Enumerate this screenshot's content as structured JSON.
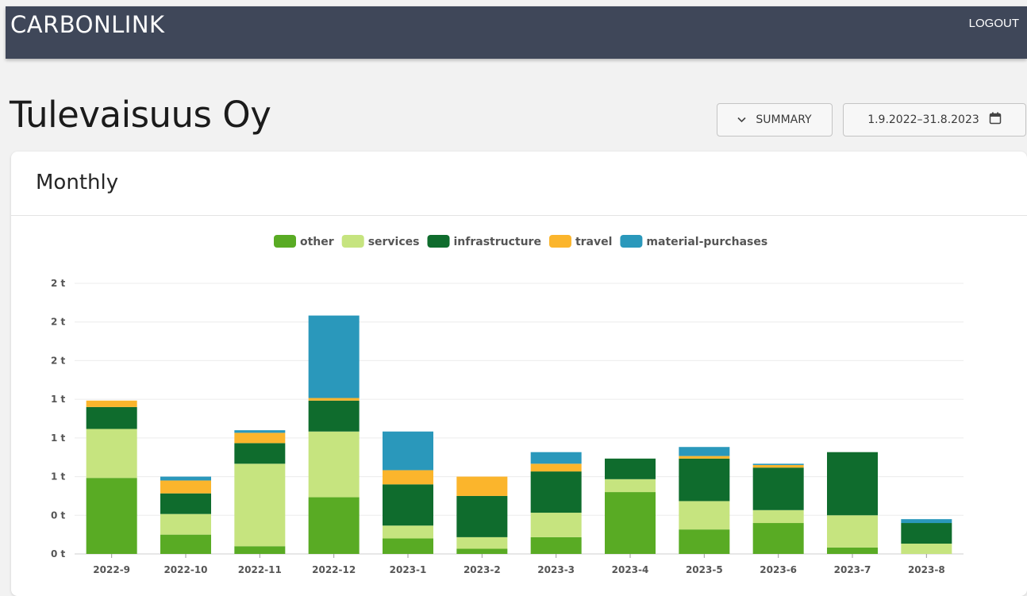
{
  "header": {
    "logo_text": "CARBONLINK",
    "logout_label": "LOGOUT"
  },
  "page": {
    "title": "Tulevaisuus Oy",
    "summary_label": "SUMMARY",
    "date_range": "1.9.2022–31.8.2023"
  },
  "card": {
    "title": "Monthly"
  },
  "colors": {
    "header_bg": "#3f4759",
    "other": "#59ab24",
    "services": "#c6e47f",
    "infrastructure": "#0f6c2d",
    "travel": "#fbb52c",
    "material-purchases": "#2a98bb"
  },
  "icons": {
    "summary_icon": "chevron-down-icon",
    "date_icon": "calendar-icon"
  },
  "chart_data": {
    "type": "bar",
    "stacked": true,
    "legend_position": "top",
    "grid": true,
    "categories": [
      "2022-9",
      "2022-10",
      "2022-11",
      "2022-12",
      "2023-1",
      "2023-2",
      "2023-3",
      "2023-4",
      "2023-5",
      "2023-6",
      "2023-7",
      "2023-8"
    ],
    "ytick_labels": [
      "0 t",
      "0 t",
      "1 t",
      "1 t",
      "1 t",
      "2 t",
      "2 t",
      "2 t"
    ],
    "ylim": [
      0,
      2.1
    ],
    "series": [
      {
        "name": "other",
        "color": "#59ab24",
        "values": [
          0.59,
          0.15,
          0.06,
          0.44,
          0.12,
          0.04,
          0.13,
          0.48,
          0.19,
          0.24,
          0.05,
          0.0
        ]
      },
      {
        "name": "services",
        "color": "#c6e47f",
        "values": [
          0.38,
          0.16,
          0.64,
          0.51,
          0.1,
          0.09,
          0.19,
          0.1,
          0.22,
          0.1,
          0.25,
          0.08
        ]
      },
      {
        "name": "infrastructure",
        "color": "#0f6c2d",
        "values": [
          0.17,
          0.16,
          0.16,
          0.24,
          0.32,
          0.32,
          0.32,
          0.16,
          0.33,
          0.33,
          0.49,
          0.16
        ]
      },
      {
        "name": "travel",
        "color": "#fbb52c",
        "values": [
          0.05,
          0.1,
          0.08,
          0.02,
          0.11,
          0.15,
          0.06,
          0.0,
          0.02,
          0.02,
          0.0,
          0.0
        ]
      },
      {
        "name": "material-purchases",
        "color": "#2a98bb",
        "values": [
          0.0,
          0.03,
          0.02,
          0.64,
          0.3,
          0.0,
          0.09,
          0.0,
          0.07,
          0.01,
          0.0,
          0.03
        ]
      }
    ]
  }
}
